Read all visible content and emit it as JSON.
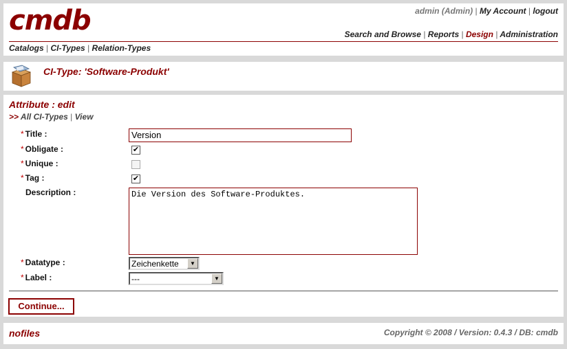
{
  "app": {
    "logo": "cmdb"
  },
  "user_bar": {
    "user": "admin (Admin)",
    "my_account": "My Account",
    "logout": "logout"
  },
  "main_nav": [
    {
      "label": "Search and Browse",
      "active": false
    },
    {
      "label": "Reports",
      "active": false
    },
    {
      "label": "Design",
      "active": true
    },
    {
      "label": "Administration",
      "active": false
    }
  ],
  "sub_nav": [
    "Catalogs",
    "CI-Types",
    "Relation-Types"
  ],
  "page": {
    "ci_title": "CI-Type: 'Software-Produkt'",
    "icon": "package-box-icon"
  },
  "form": {
    "heading": "Attribute : edit",
    "breadcrumb": {
      "arrow": ">>",
      "all": "All CI-Types",
      "view": "View"
    },
    "required_mark": "*",
    "fields": {
      "title": {
        "label": "Title :",
        "value": "Version",
        "required": true
      },
      "obligate": {
        "label": "Obligate :",
        "checked": true,
        "required": true
      },
      "unique": {
        "label": "Unique :",
        "checked": false,
        "required": true
      },
      "tag": {
        "label": "Tag :",
        "checked": true,
        "required": true
      },
      "description": {
        "label": "Description :",
        "value": "Die Version des Software-Produktes.",
        "required": false
      },
      "datatype": {
        "label": "Datatype :",
        "value": "Zeichenkette",
        "required": true
      },
      "label": {
        "label": "Label :",
        "value": "---",
        "required": true
      }
    },
    "continue_label": "Continue..."
  },
  "footer": {
    "logo": "nofiles",
    "copyright": "Copyright © 2008 / Version: 0.4.3 / DB: cmdb"
  },
  "colors": {
    "accent": "#8b0000",
    "background": "#d9d9d9"
  }
}
